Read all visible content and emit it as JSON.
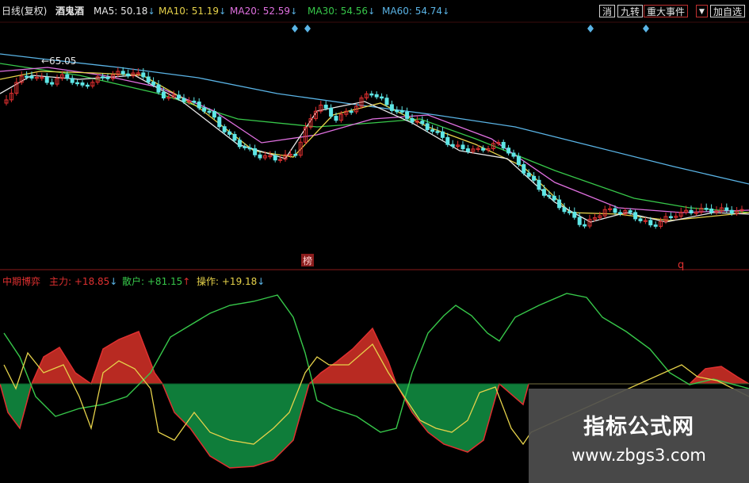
{
  "header": {
    "period_label": "日线(复权)",
    "formula_name": "酒鬼酒",
    "ma5": {
      "label": "MA5:",
      "value": "50.18",
      "arrow": "↓",
      "color": "#e8e8e8"
    },
    "ma10": {
      "label": "MA10:",
      "value": "51.19",
      "arrow": "↓",
      "color": "#e6d24a"
    },
    "ma20": {
      "label": "MA20:",
      "value": "52.59",
      "arrow": "↓",
      "color": "#e070e0"
    },
    "ma30": {
      "label": "MA30:",
      "value": "54.56",
      "arrow": "↓",
      "color": "#37c84a"
    },
    "ma60": {
      "label": "MA60:",
      "value": "54.74",
      "arrow": "↓",
      "color": "#5ab4e6"
    }
  },
  "toolbar": {
    "btn_xiao": "消",
    "btn_jiuzhuan": "九转",
    "btn_events": "重大事件",
    "btn_dropdown": "▼",
    "btn_add": "加自选"
  },
  "main_chart": {
    "high_price_label": "←65.05",
    "marker_bang": "榜",
    "marker_q": "q"
  },
  "indicator": {
    "name": "中期博弈",
    "zhuli": {
      "label": "主力:",
      "value": "+18.85",
      "arrow": "↓",
      "color": "#e03030"
    },
    "sanhu": {
      "label": "散户:",
      "value": "+81.15",
      "arrow": "↑",
      "color": "#37c84a"
    },
    "caozuo": {
      "label": "操作:",
      "value": "+19.18",
      "arrow": "↓",
      "color": "#e6d24a"
    }
  },
  "watermark": {
    "title": "指标公式网",
    "url": "www.zbgs3.com"
  },
  "colors": {
    "background": "#000000",
    "up_candle": "#e03030",
    "down_candle": "#5ee6e6",
    "fill_red": "#b82a22",
    "fill_green": "#0f7d3a"
  }
}
